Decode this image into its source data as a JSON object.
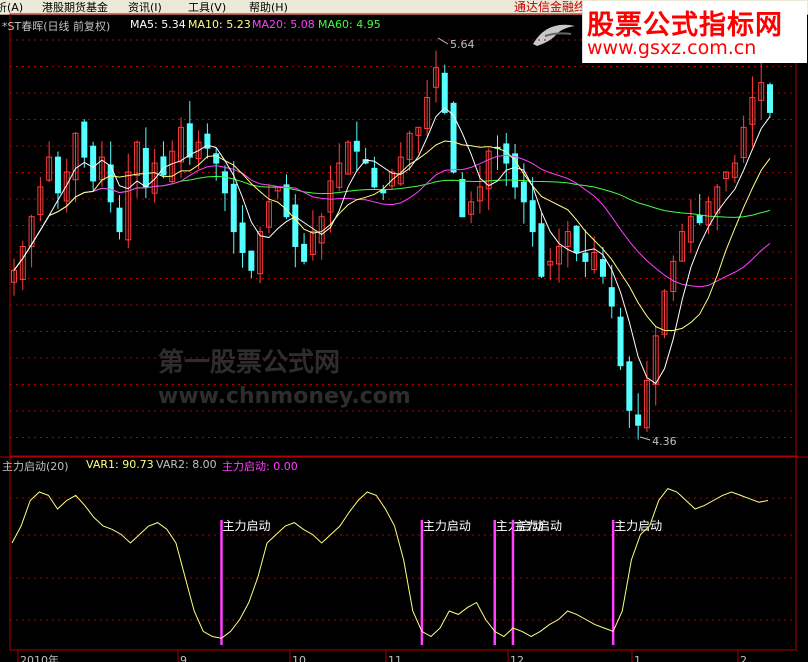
{
  "menu": [
    "析(A)",
    "港股期货基金",
    "资讯(I)",
    "工具(V)",
    "帮助(H)"
  ],
  "ad_text": "通达信金融终端",
  "watermark": {
    "title": "股票公式指标网",
    "url": "www.gsxz.com.cn"
  },
  "main_header": {
    "title": "*ST春晖(日线 前复权)",
    "ma5": "MA5: 5.34",
    "ma10": "MA10: 5.23",
    "ma20": "MA20: 5.08",
    "ma60": "MA60: 4.95"
  },
  "high_label": "5.64",
  "low_label": "4.36",
  "ghost_watermark": {
    "line1": "第一股票公式网",
    "line2": "www.chnmoney.com"
  },
  "sub_header": {
    "name": "主力启动(20)",
    "var1": "VAR1: 90.73",
    "var2": "VAR2: 8.00",
    "signal": "主力启动: 0.00"
  },
  "signal_label": "主力启动",
  "date_axis": [
    "2010年",
    "9",
    "10",
    "11",
    "12",
    "1",
    "2"
  ],
  "colors": {
    "up": "#ff3c3c",
    "down": "#54ffff",
    "ma5": "#ffffff",
    "ma10": "#ffff80",
    "ma20": "#ff40ff",
    "ma60": "#40ff40",
    "grid": "#b00000",
    "signal": "#ff40ff",
    "var1": "#ffff80"
  },
  "chart_data": [
    {
      "type": "candlestick",
      "title": "*ST春晖(日线 前复权)",
      "close_path": [
        4.92,
        5.0,
        5.1,
        5.2,
        5.3,
        5.18,
        5.25,
        5.38,
        5.3,
        5.22,
        5.3,
        5.15,
        5.05,
        5.25,
        5.35,
        5.2,
        5.28,
        5.24,
        5.32,
        5.4,
        5.3,
        5.35,
        5.33,
        5.28,
        5.18,
        5.05,
        4.98,
        4.92,
        5.05,
        5.15,
        5.2,
        5.1,
        5.0,
        4.95,
        5.05,
        5.1,
        5.22,
        5.28,
        5.35,
        5.32,
        5.28,
        5.2,
        5.18,
        5.25,
        5.3,
        5.38,
        5.4,
        5.5,
        5.6,
        5.45,
        5.25,
        5.1,
        5.15,
        5.2,
        5.32,
        5.33,
        5.28,
        5.2,
        5.15,
        5.05,
        4.9,
        4.95,
        5.0,
        5.05,
        4.98,
        4.95,
        4.98,
        4.9,
        4.8,
        4.6,
        4.45,
        4.4,
        4.55,
        4.7,
        4.85,
        4.95,
        5.05,
        5.1,
        5.08,
        5.15,
        5.2,
        5.25,
        5.28,
        5.4,
        5.5,
        5.55,
        5.45
      ],
      "high": 5.64,
      "low": 4.36,
      "ma": {
        "MA5": 5.34,
        "MA10": 5.23,
        "MA20": 5.08,
        "MA60": 4.95
      }
    },
    {
      "type": "line",
      "title": "主力启动(20)",
      "series": [
        {
          "name": "VAR1",
          "values": [
            60,
            70,
            85,
            90,
            88,
            80,
            85,
            88,
            82,
            75,
            70,
            68,
            65,
            60,
            65,
            70,
            72,
            68,
            60,
            40,
            20,
            8,
            5,
            4,
            8,
            15,
            25,
            40,
            60,
            65,
            70,
            72,
            68,
            65,
            60,
            65,
            70,
            78,
            85,
            90,
            88,
            80,
            70,
            50,
            20,
            8,
            5,
            10,
            20,
            18,
            22,
            25,
            15,
            8,
            5,
            10,
            8,
            5,
            8,
            12,
            15,
            20,
            18,
            15,
            12,
            10,
            8,
            20,
            50,
            65,
            70,
            85,
            92,
            90,
            85,
            80,
            82,
            85,
            88,
            90,
            88,
            86,
            84,
            85
          ]
        },
        {
          "name": "主力启动",
          "values": [
            0,
            0,
            0,
            0,
            0,
            0,
            0,
            0,
            0,
            0,
            0,
            0,
            0,
            0,
            0,
            0,
            0,
            0,
            0,
            0,
            0,
            0,
            0,
            1,
            0,
            0,
            0,
            0,
            0,
            0,
            0,
            0,
            0,
            0,
            0,
            0,
            0,
            0,
            0,
            0,
            0,
            0,
            0,
            0,
            0,
            1,
            0,
            0,
            0,
            0,
            0,
            0,
            0,
            1,
            0,
            1,
            0,
            0,
            0,
            0,
            0,
            0,
            0,
            0,
            0,
            0,
            1,
            0,
            0,
            0,
            0,
            0,
            0,
            0,
            0,
            0,
            0,
            0,
            0,
            0,
            0,
            0,
            0,
            0
          ]
        }
      ],
      "var1_last": 90.73,
      "var2": 8.0
    }
  ]
}
